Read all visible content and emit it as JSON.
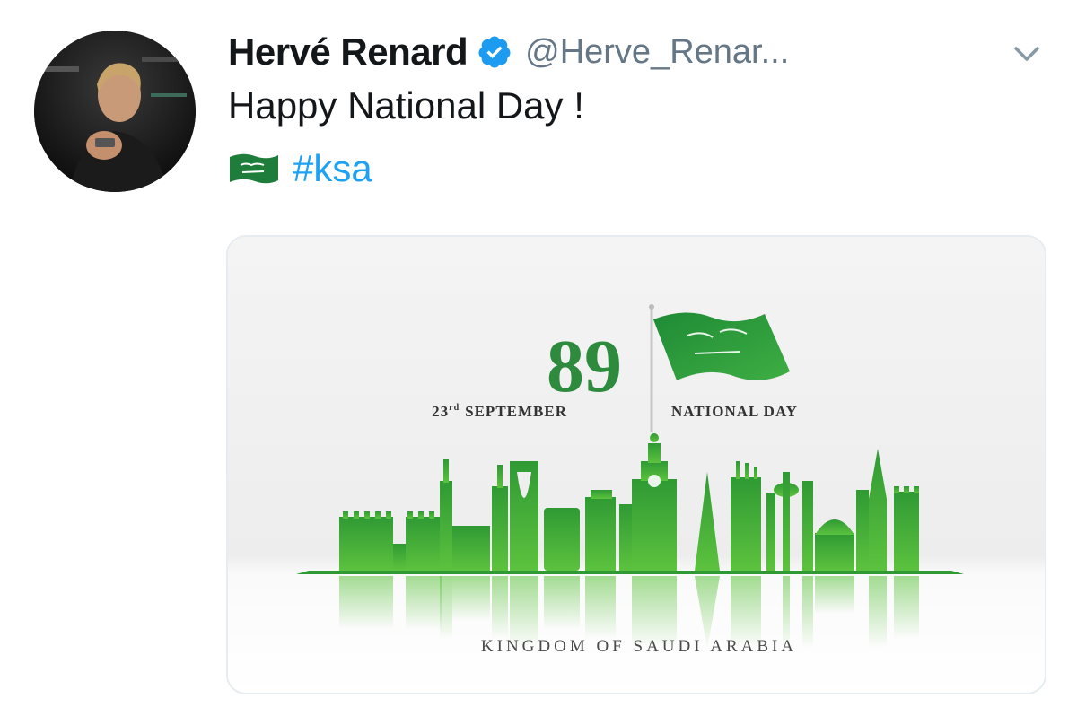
{
  "tweet": {
    "author_name": "Hervé Renard",
    "handle": "@Herve_Renar...",
    "text": "Happy National Day !",
    "hashtag": "#ksa",
    "verified_icon": "verified-badge-icon",
    "flag_icon": "saudi-flag-icon",
    "menu_icon": "chevron-down-icon"
  },
  "media": {
    "number": "89",
    "date_prefix": "23",
    "date_suffix": "rd",
    "date_month": "SEPTEMBER",
    "event": "NATIONAL DAY",
    "country": "KINGDOM OF SAUDI ARABIA"
  },
  "colors": {
    "accent_blue": "#1da1f2",
    "verified_blue": "#1d9bf0",
    "name_text": "#14171a",
    "handle_gray": "#657786",
    "poster_green": "#2e8b3e",
    "skyline_green": "#3aa63a"
  }
}
